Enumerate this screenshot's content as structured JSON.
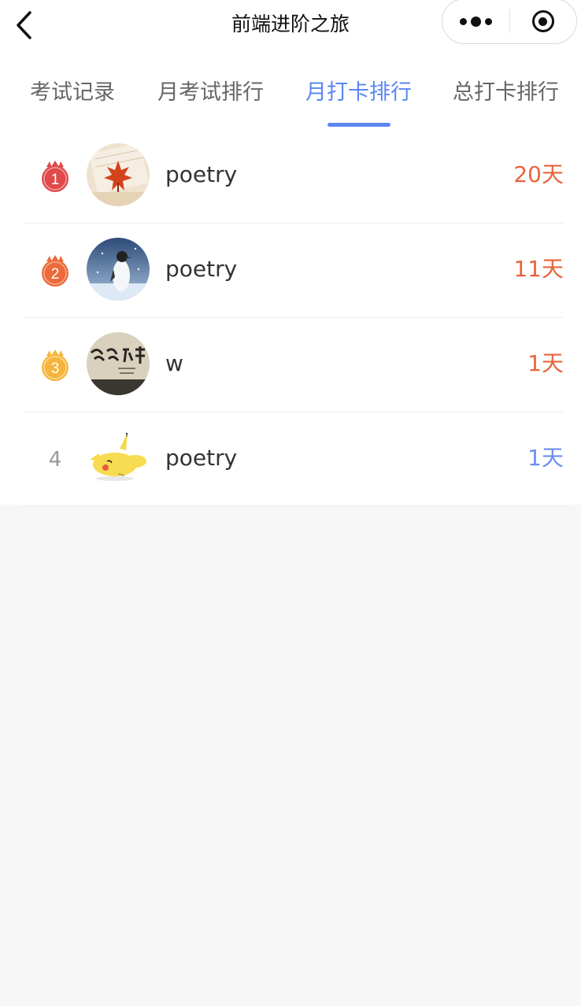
{
  "navbar": {
    "title": "前端进阶之旅",
    "back_icon": "chevron-left-icon",
    "more_icon": "more-dots-icon",
    "close_icon": "target-circle-icon"
  },
  "tabs": [
    {
      "label": "考试记录",
      "active": false
    },
    {
      "label": "月考试排行",
      "active": false
    },
    {
      "label": "月打卡排行",
      "active": true
    },
    {
      "label": "总打卡排行",
      "active": false
    }
  ],
  "colors": {
    "accent": "#5b87f2",
    "days_orange": "#e8643c",
    "days_blue": "#6b8ff0",
    "medal_gold": "#e04a4a",
    "medal_silver": "#ec6a3c",
    "medal_bronze": "#f5b53c"
  },
  "ranking": [
    {
      "rank": "1",
      "medal": "red-medal-icon",
      "avatar": "maple-leaf-avatar",
      "name": "poetry",
      "days": "20天"
    },
    {
      "rank": "2",
      "medal": "orange-medal-icon",
      "avatar": "penguin-avatar",
      "name": "poetry",
      "days": "11天"
    },
    {
      "rank": "3",
      "medal": "yellow-medal-icon",
      "avatar": "calligraphy-avatar",
      "name": "w",
      "days": "1天"
    },
    {
      "rank": "4",
      "medal": "",
      "avatar": "pikachu-avatar",
      "name": "poetry",
      "days": "1天"
    }
  ]
}
